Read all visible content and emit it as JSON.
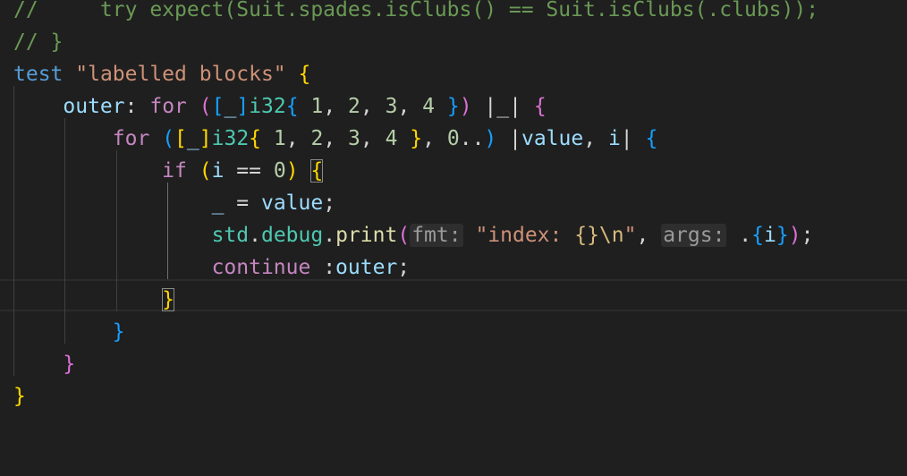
{
  "editor": {
    "lines": [
      {
        "name": "code-line-1",
        "indent": "",
        "tokens": [
          {
            "text": "//     try expect(Suit.spades.isClubs() == Suit.isClubs(.clubs));",
            "cls": "c-comment"
          }
        ]
      },
      {
        "name": "code-line-2",
        "indent": "",
        "tokens": [
          {
            "text": "// }",
            "cls": "c-comment"
          }
        ]
      },
      {
        "name": "code-line-3",
        "indent": "",
        "tokens": [
          {
            "text": "test",
            "cls": "c-kw"
          },
          {
            "text": " "
          },
          {
            "text": "\"labelled blocks\"",
            "cls": "c-str"
          },
          {
            "text": " "
          },
          {
            "text": "{",
            "cls": "b1"
          }
        ]
      },
      {
        "name": "code-line-4",
        "indent": "    ",
        "tokens": [
          {
            "text": "outer",
            "cls": "c-label"
          },
          {
            "text": ": "
          },
          {
            "text": "for",
            "cls": "c-ctl"
          },
          {
            "text": " "
          },
          {
            "text": "(",
            "cls": "b2"
          },
          {
            "text": "[",
            "cls": "b3"
          },
          {
            "text": "_",
            "cls": "c-var"
          },
          {
            "text": "]",
            "cls": "b3"
          },
          {
            "text": "i32",
            "cls": "c-type"
          },
          {
            "text": "{",
            "cls": "b3"
          },
          {
            "text": " "
          },
          {
            "text": "1",
            "cls": "c-num"
          },
          {
            "text": ", "
          },
          {
            "text": "2",
            "cls": "c-num"
          },
          {
            "text": ", "
          },
          {
            "text": "3",
            "cls": "c-num"
          },
          {
            "text": ", "
          },
          {
            "text": "4",
            "cls": "c-num"
          },
          {
            "text": " "
          },
          {
            "text": "}",
            "cls": "b3"
          },
          {
            "text": ")",
            "cls": "b2"
          },
          {
            "text": " |_| "
          },
          {
            "text": "{",
            "cls": "b2"
          }
        ]
      },
      {
        "name": "code-line-5",
        "indent": "        ",
        "tokens": [
          {
            "text": "for",
            "cls": "c-ctl"
          },
          {
            "text": " "
          },
          {
            "text": "(",
            "cls": "b3"
          },
          {
            "text": "[",
            "cls": "b1"
          },
          {
            "text": "_",
            "cls": "c-var"
          },
          {
            "text": "]",
            "cls": "b1"
          },
          {
            "text": "i32",
            "cls": "c-type"
          },
          {
            "text": "{",
            "cls": "b1"
          },
          {
            "text": " "
          },
          {
            "text": "1",
            "cls": "c-num"
          },
          {
            "text": ", "
          },
          {
            "text": "2",
            "cls": "c-num"
          },
          {
            "text": ", "
          },
          {
            "text": "3",
            "cls": "c-num"
          },
          {
            "text": ", "
          },
          {
            "text": "4",
            "cls": "c-num"
          },
          {
            "text": " "
          },
          {
            "text": "}",
            "cls": "b1"
          },
          {
            "text": ", "
          },
          {
            "text": "0",
            "cls": "c-num"
          },
          {
            "text": ".."
          },
          {
            "text": ")",
            "cls": "b3"
          },
          {
            "text": " |"
          },
          {
            "text": "value",
            "cls": "c-var"
          },
          {
            "text": ", "
          },
          {
            "text": "i",
            "cls": "c-var"
          },
          {
            "text": "| "
          },
          {
            "text": "{",
            "cls": "b3"
          }
        ]
      },
      {
        "name": "code-line-6",
        "indent": "            ",
        "tokens": [
          {
            "text": "if",
            "cls": "c-ctl"
          },
          {
            "text": " "
          },
          {
            "text": "(",
            "cls": "b1"
          },
          {
            "text": "i",
            "cls": "c-var"
          },
          {
            "text": " == "
          },
          {
            "text": "0",
            "cls": "c-num"
          },
          {
            "text": ")",
            "cls": "b1"
          },
          {
            "text": " "
          },
          {
            "text": "{",
            "cls": "b1 match"
          }
        ]
      },
      {
        "name": "code-line-7",
        "indent": "                ",
        "tokens": [
          {
            "text": "_",
            "cls": "c-var"
          },
          {
            "text": " = "
          },
          {
            "text": "value",
            "cls": "c-var"
          },
          {
            "text": ";"
          }
        ]
      },
      {
        "name": "code-line-8",
        "indent": "                ",
        "tokens": [
          {
            "text": "std",
            "cls": "c-type"
          },
          {
            "text": "."
          },
          {
            "text": "debug",
            "cls": "c-type"
          },
          {
            "text": "."
          },
          {
            "text": "print",
            "cls": "c-fn"
          },
          {
            "text": "(",
            "cls": "b2"
          },
          {
            "text": "fmt:",
            "cls": "hint"
          },
          {
            "text": " "
          },
          {
            "text": "\"index: ",
            "cls": "c-str"
          },
          {
            "text": "{}",
            "cls": "c-esc"
          },
          {
            "text": "\\n",
            "cls": "c-esc"
          },
          {
            "text": "\"",
            "cls": "c-str"
          },
          {
            "text": ", "
          },
          {
            "text": "args:",
            "cls": "hint"
          },
          {
            "text": " ."
          },
          {
            "text": "{",
            "cls": "b3"
          },
          {
            "text": "i",
            "cls": "c-var"
          },
          {
            "text": "}",
            "cls": "b3"
          },
          {
            "text": ")",
            "cls": "b2"
          },
          {
            "text": ";"
          }
        ]
      },
      {
        "name": "code-line-9",
        "indent": "                ",
        "tokens": [
          {
            "text": "continue",
            "cls": "c-ctl"
          },
          {
            "text": " :"
          },
          {
            "text": "outer",
            "cls": "c-label"
          },
          {
            "text": ";"
          }
        ]
      },
      {
        "name": "code-line-10",
        "indent": "            ",
        "tokens": [
          {
            "text": "}",
            "cls": "b1 match"
          }
        ]
      },
      {
        "name": "code-line-11",
        "indent": "        ",
        "tokens": [
          {
            "text": "}",
            "cls": "b3"
          }
        ]
      },
      {
        "name": "code-line-12",
        "indent": "    ",
        "tokens": [
          {
            "text": "}",
            "cls": "b2"
          }
        ]
      },
      {
        "name": "code-line-13",
        "indent": "",
        "tokens": [
          {
            "text": "}",
            "cls": "b1"
          }
        ]
      }
    ]
  }
}
